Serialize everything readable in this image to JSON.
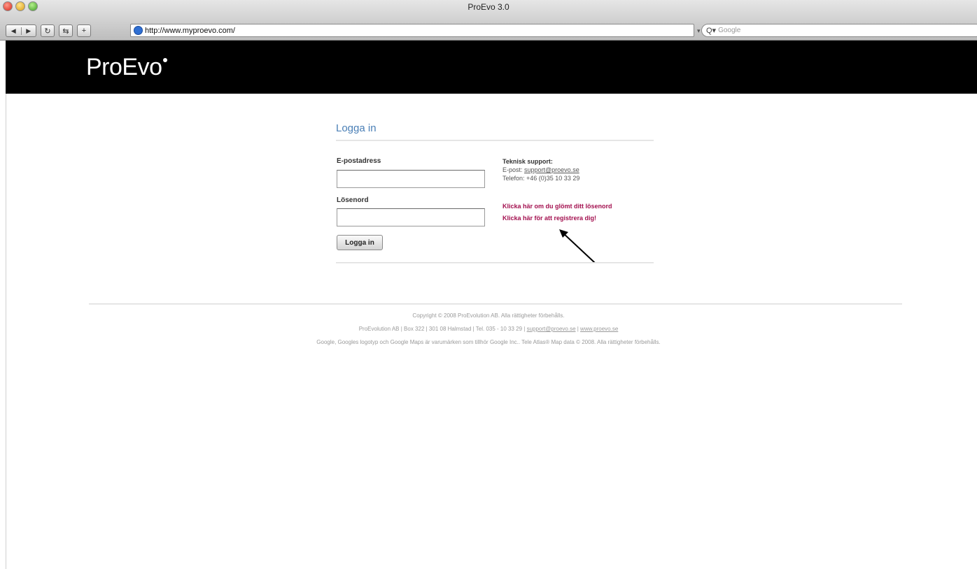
{
  "window": {
    "title": "ProEvo 3.0"
  },
  "toolbar": {
    "back_icon": "back-arrow-icon",
    "forward_icon": "forward-arrow-icon",
    "reload_icon": "reload-icon",
    "url": "http://www.myproevo.com/",
    "search_placeholder": "Google"
  },
  "header": {
    "logo_text": "ProEvo"
  },
  "login": {
    "title": "Logga in",
    "email_label": "E-postadress",
    "email_value": "",
    "password_label": "Lösenord",
    "password_value": "",
    "submit_label": "Logga in"
  },
  "support": {
    "title": "Teknisk support:",
    "email_prefix": "E-post: ",
    "email_link": "support@proevo.se",
    "phone": "Telefon: +46 (0)35 10 33 29",
    "forgot_link": "Klicka här om du glömt ditt lösenord",
    "register_link": "Klicka här för att registrera dig!"
  },
  "footer": {
    "copyright": "Copyright © 2008 ProEvolution AB. Alla rättigheter förbehålls.",
    "address": "ProEvolution AB | Box 322 | 301 08 Halmstad | Tel. 035 - 10 33 29 | ",
    "email_link": "support@proevo.se",
    "separator": " | ",
    "web_link": "www.proevo.se",
    "google_notice": "Google, Googles logotyp och Google Maps är varumärken som tillhör Google Inc.. Tele Atlas® Map data © 2008. Alla rättigheter förbehålls."
  }
}
